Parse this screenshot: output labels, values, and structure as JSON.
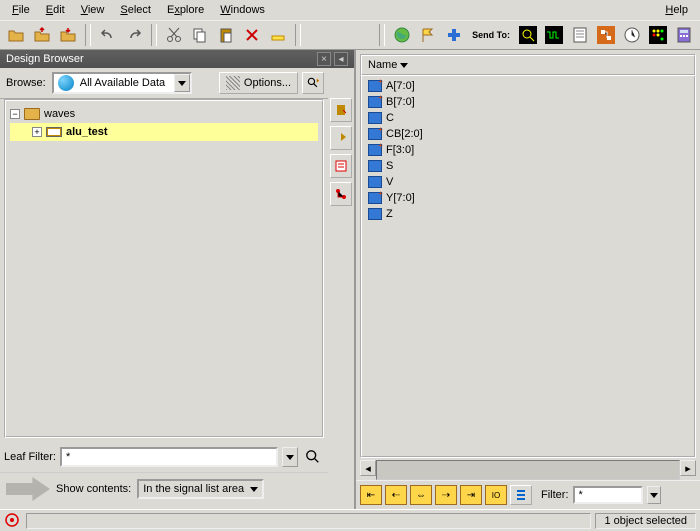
{
  "menu": {
    "file": "File",
    "edit": "Edit",
    "view": "View",
    "select": "Select",
    "explore": "Explore",
    "windows": "Windows",
    "help": "Help"
  },
  "sendto_label": "Send To:",
  "panel_title": "Design Browser",
  "browse": {
    "label": "Browse:",
    "combo_value": "All Available Data",
    "options_label": "Options..."
  },
  "tree": {
    "root": "waves",
    "child": "alu_test"
  },
  "leaf": {
    "label": "Leaf Filter:",
    "value": "*"
  },
  "show": {
    "label": "Show contents:",
    "combo_value": "In the signal list area"
  },
  "name_hdr": "Name",
  "signals": [
    {
      "label": "A[7:0]",
      "bus": true
    },
    {
      "label": "B[7:0]",
      "bus": true
    },
    {
      "label": "C",
      "bus": false
    },
    {
      "label": "CB[2:0]",
      "bus": true
    },
    {
      "label": "F[3:0]",
      "bus": true
    },
    {
      "label": "S",
      "bus": false
    },
    {
      "label": "V",
      "bus": false
    },
    {
      "label": "Y[7:0]",
      "bus": true
    },
    {
      "label": "Z",
      "bus": false
    }
  ],
  "filter": {
    "label": "Filter:",
    "value": "*"
  },
  "status": "1 object selected"
}
